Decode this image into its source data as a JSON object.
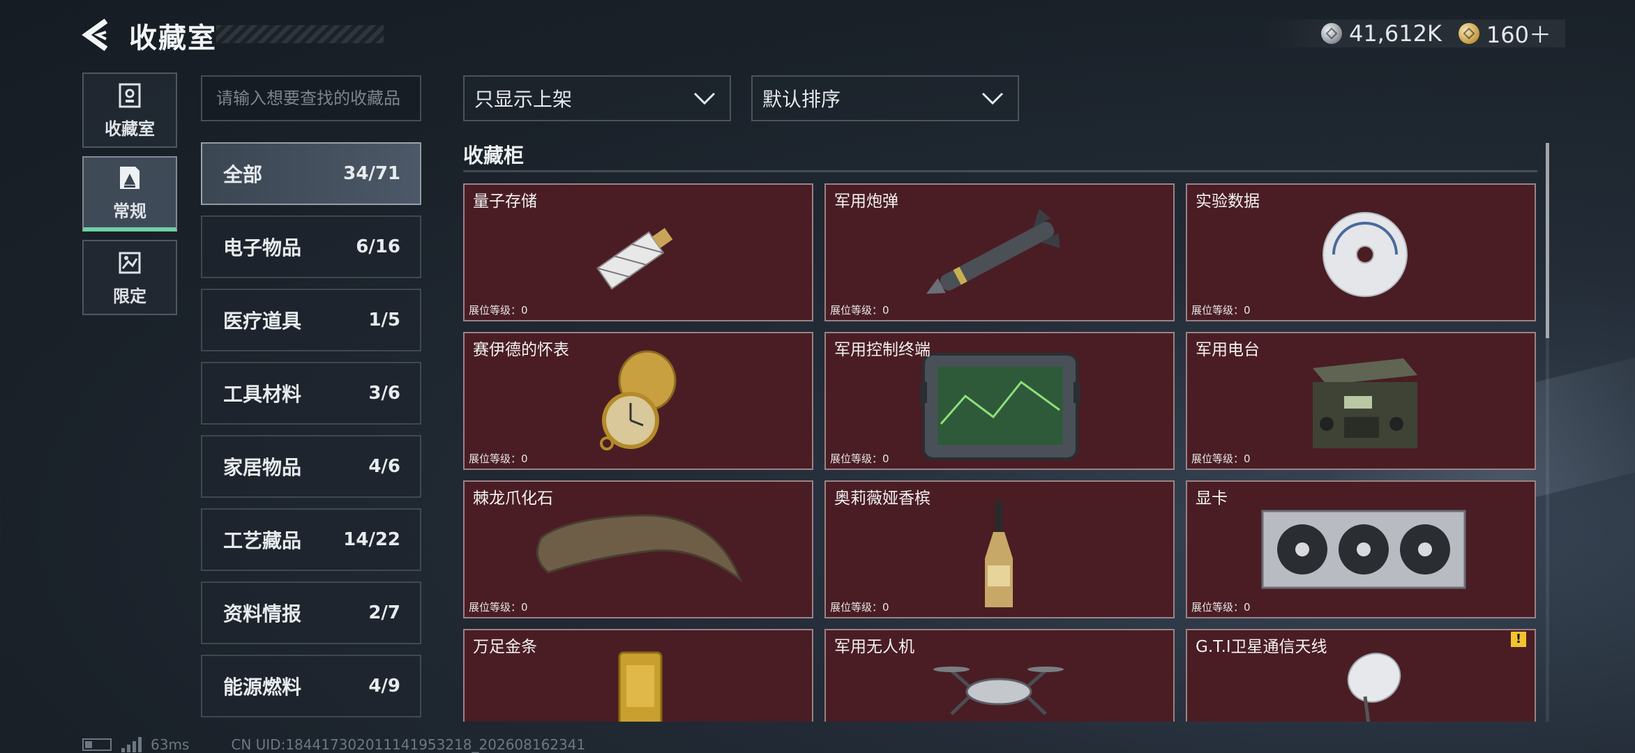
{
  "header": {
    "title": "收藏室",
    "currency": [
      {
        "icon": "silver-coin-icon",
        "value": "41,612K"
      },
      {
        "icon": "gold-coin-icon",
        "value": "160＋"
      }
    ]
  },
  "side_nav": [
    {
      "label": "收藏室",
      "icon": "collection-room-icon",
      "active": false
    },
    {
      "label": "常规",
      "icon": "regular-icon",
      "active": true
    },
    {
      "label": "限定",
      "icon": "limited-icon",
      "active": false
    }
  ],
  "search": {
    "placeholder": "请输入想要查找的收藏品",
    "value": ""
  },
  "categories": [
    {
      "name": "全部",
      "count": "34/71",
      "active": true
    },
    {
      "name": "电子物品",
      "count": "6/16"
    },
    {
      "name": "医疗道具",
      "count": "1/5"
    },
    {
      "name": "工具材料",
      "count": "3/6"
    },
    {
      "name": "家居物品",
      "count": "4/6"
    },
    {
      "name": "工艺藏品",
      "count": "14/22"
    },
    {
      "name": "资料情报",
      "count": "2/7"
    },
    {
      "name": "能源燃料",
      "count": "4/9"
    }
  ],
  "filters": {
    "display": "只显示上架",
    "sort": "默认排序"
  },
  "cabinet": {
    "title": "收藏柜",
    "items": [
      {
        "name": "量子存储",
        "level": "展位等级：0",
        "icon": "usb-drive-icon"
      },
      {
        "name": "军用炮弹",
        "level": "展位等级：0",
        "icon": "missile-icon"
      },
      {
        "name": "实验数据",
        "level": "展位等级：0",
        "icon": "disc-icon"
      },
      {
        "name": "赛伊德的怀表",
        "level": "展位等级：0",
        "icon": "pocket-watch-icon"
      },
      {
        "name": "军用控制终端",
        "level": "展位等级：0",
        "icon": "control-terminal-icon"
      },
      {
        "name": "军用电台",
        "level": "展位等级：0",
        "icon": "radio-icon"
      },
      {
        "name": "棘龙爪化石",
        "level": "展位等级：0",
        "icon": "claw-fossil-icon"
      },
      {
        "name": "奥莉薇娅香槟",
        "level": "展位等级：0",
        "icon": "champagne-bottle-icon"
      },
      {
        "name": "显卡",
        "level": "展位等级：0",
        "icon": "graphics-card-icon"
      },
      {
        "name": "万足金条",
        "level": "",
        "icon": "gold-bar-icon"
      },
      {
        "name": "军用无人机",
        "level": "",
        "icon": "drone-icon"
      },
      {
        "name": "G.T.I卫星通信天线",
        "level": "",
        "icon": "satellite-dish-icon",
        "warning": "!"
      }
    ]
  },
  "footer": {
    "ping": "63ms",
    "uid": "CN UID:18441730201114195321​8_202608162341"
  }
}
